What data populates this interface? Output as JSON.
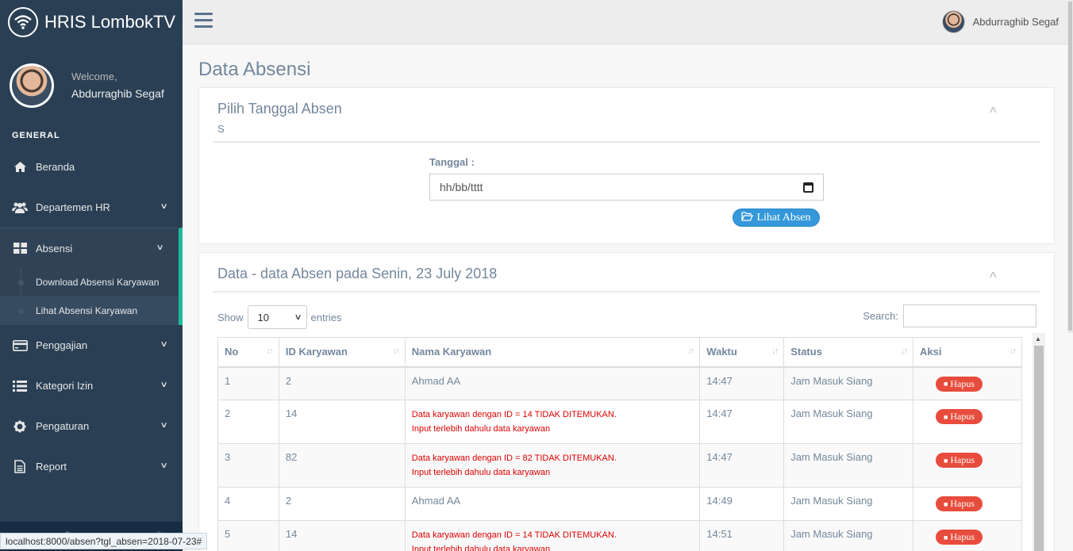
{
  "brand": {
    "title": "HRIS LombokTV"
  },
  "profile": {
    "welcome": "Welcome,",
    "name": "Abdurraghib Segaf"
  },
  "sidebar": {
    "section": "GENERAL",
    "items": [
      {
        "label": "Beranda",
        "icon": "home-icon"
      },
      {
        "label": "Departemen HR",
        "icon": "users-icon"
      },
      {
        "label": "Absensi",
        "icon": "grid-icon"
      },
      {
        "label": "Penggajian",
        "icon": "credit-card-icon"
      },
      {
        "label": "Kategori Izin",
        "icon": "list-icon"
      },
      {
        "label": "Pengaturan",
        "icon": "gear-icon"
      },
      {
        "label": "Report",
        "icon": "document-icon"
      }
    ],
    "submenu": [
      {
        "label": "Download Absensi Karyawan"
      },
      {
        "label": "Lihat Absensi Karyawan"
      }
    ]
  },
  "topnav": {
    "user_name": "Abdurraghib Segaf"
  },
  "page": {
    "title": "Data Absensi"
  },
  "date_panel": {
    "title": "Pilih Tanggal Absen",
    "subtitle": "S",
    "field_label": "Tanggal :",
    "date_placeholder": "hh/bb/tttt",
    "button_label": "Lihat Absen"
  },
  "data_panel": {
    "title": "Data - data Absen pada Senin, 23 July 2018",
    "show_label": "Show",
    "entries_value": "10",
    "entries_label": "entries",
    "search_label": "Search:",
    "columns": [
      "No",
      "ID Karyawan",
      "Nama Karyawan",
      "Waktu",
      "Status",
      "Aksi"
    ],
    "action_label": "Hapus",
    "rows": [
      {
        "no": "1",
        "id": "2",
        "name": "Ahmad AA",
        "err1": "",
        "err2": "",
        "time": "14:47",
        "status": "Jam Masuk Siang"
      },
      {
        "no": "2",
        "id": "14",
        "name": "",
        "err1": "Data karyawan dengan ID = 14 TIDAK DITEMUKAN.",
        "err2": "Input terlebih dahulu data karyawan",
        "time": "14:47",
        "status": "Jam Masuk Siang"
      },
      {
        "no": "3",
        "id": "82",
        "name": "",
        "err1": "Data karyawan dengan ID = 82 TIDAK DITEMUKAN.",
        "err2": "Input terlebih dahulu data karyawan",
        "time": "14:47",
        "status": "Jam Masuk Siang"
      },
      {
        "no": "4",
        "id": "2",
        "name": "Ahmad AA",
        "err1": "",
        "err2": "",
        "time": "14:49",
        "status": "Jam Masuk Siang"
      },
      {
        "no": "5",
        "id": "14",
        "name": "",
        "err1": "Data karyawan dengan ID = 14 TIDAK DITEMUKAN.",
        "err2": "Input terlebih dahulu data karyawan",
        "time": "14:51",
        "status": "Jam Masuk Siang"
      }
    ]
  },
  "statusbar": {
    "url": "localhost:8000/absen?tgl_absen=2018-07-23#"
  },
  "colors": {
    "sidebar": "#2A3F54",
    "accent": "#1ABB9C",
    "primary": "#3498DB",
    "danger": "#E74C3C",
    "error_text": "#DD0000"
  }
}
